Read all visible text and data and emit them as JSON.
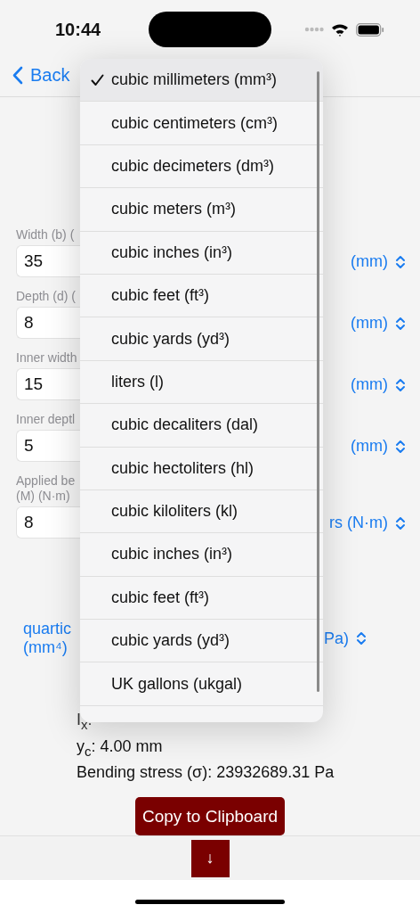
{
  "status_bar": {
    "time": "10:44"
  },
  "nav": {
    "back": "Back"
  },
  "form": {
    "fields": [
      {
        "label": [
          "Width (b) ("
        ],
        "value": "35",
        "unit": "(mm)"
      },
      {
        "label": [
          "Depth (d) ("
        ],
        "value": "8",
        "unit": "(mm)"
      },
      {
        "label": [
          "Inner width"
        ],
        "value": "15",
        "unit": "(mm)"
      },
      {
        "label": [
          "Inner deptl"
        ],
        "value": "5",
        "unit": "(mm)"
      },
      {
        "label": [
          "Applied be",
          "(M) (N·m)"
        ],
        "value": "8",
        "unit": "rs (N·m)"
      }
    ]
  },
  "result_units": {
    "left": [
      "quartic",
      "(mm⁴)"
    ],
    "right": "Pa)"
  },
  "results": [
    "I$_{x}$:",
    "y$_{c}$: 4.00  mm",
    "Bending stress (σ): 23932689.31  Pa"
  ],
  "copy_button": "Copy to Clipboard",
  "scroll_button": "↓",
  "menu": {
    "items": [
      {
        "label": "cubic millimeters (mm³)",
        "selected": true
      },
      {
        "label": "cubic centimeters (cm³)",
        "selected": false
      },
      {
        "label": "cubic decimeters (dm³)",
        "selected": false
      },
      {
        "label": "cubic meters (m³)",
        "selected": false
      },
      {
        "label": "cubic inches (in³)",
        "selected": false
      },
      {
        "label": "cubic feet (ft³)",
        "selected": false
      },
      {
        "label": "cubic yards (yd³)",
        "selected": false
      },
      {
        "label": "liters (l)",
        "selected": false
      },
      {
        "label": "cubic decaliters (dal)",
        "selected": false
      },
      {
        "label": "cubic hectoliters (hl)",
        "selected": false
      },
      {
        "label": "cubic kiloliters (kl)",
        "selected": false
      },
      {
        "label": "cubic inches (in³)",
        "selected": false
      },
      {
        "label": "cubic feet (ft³)",
        "selected": false
      },
      {
        "label": "cubic yards (yd³)",
        "selected": false
      },
      {
        "label": "UK gallons (ukgal)",
        "selected": false
      }
    ]
  }
}
